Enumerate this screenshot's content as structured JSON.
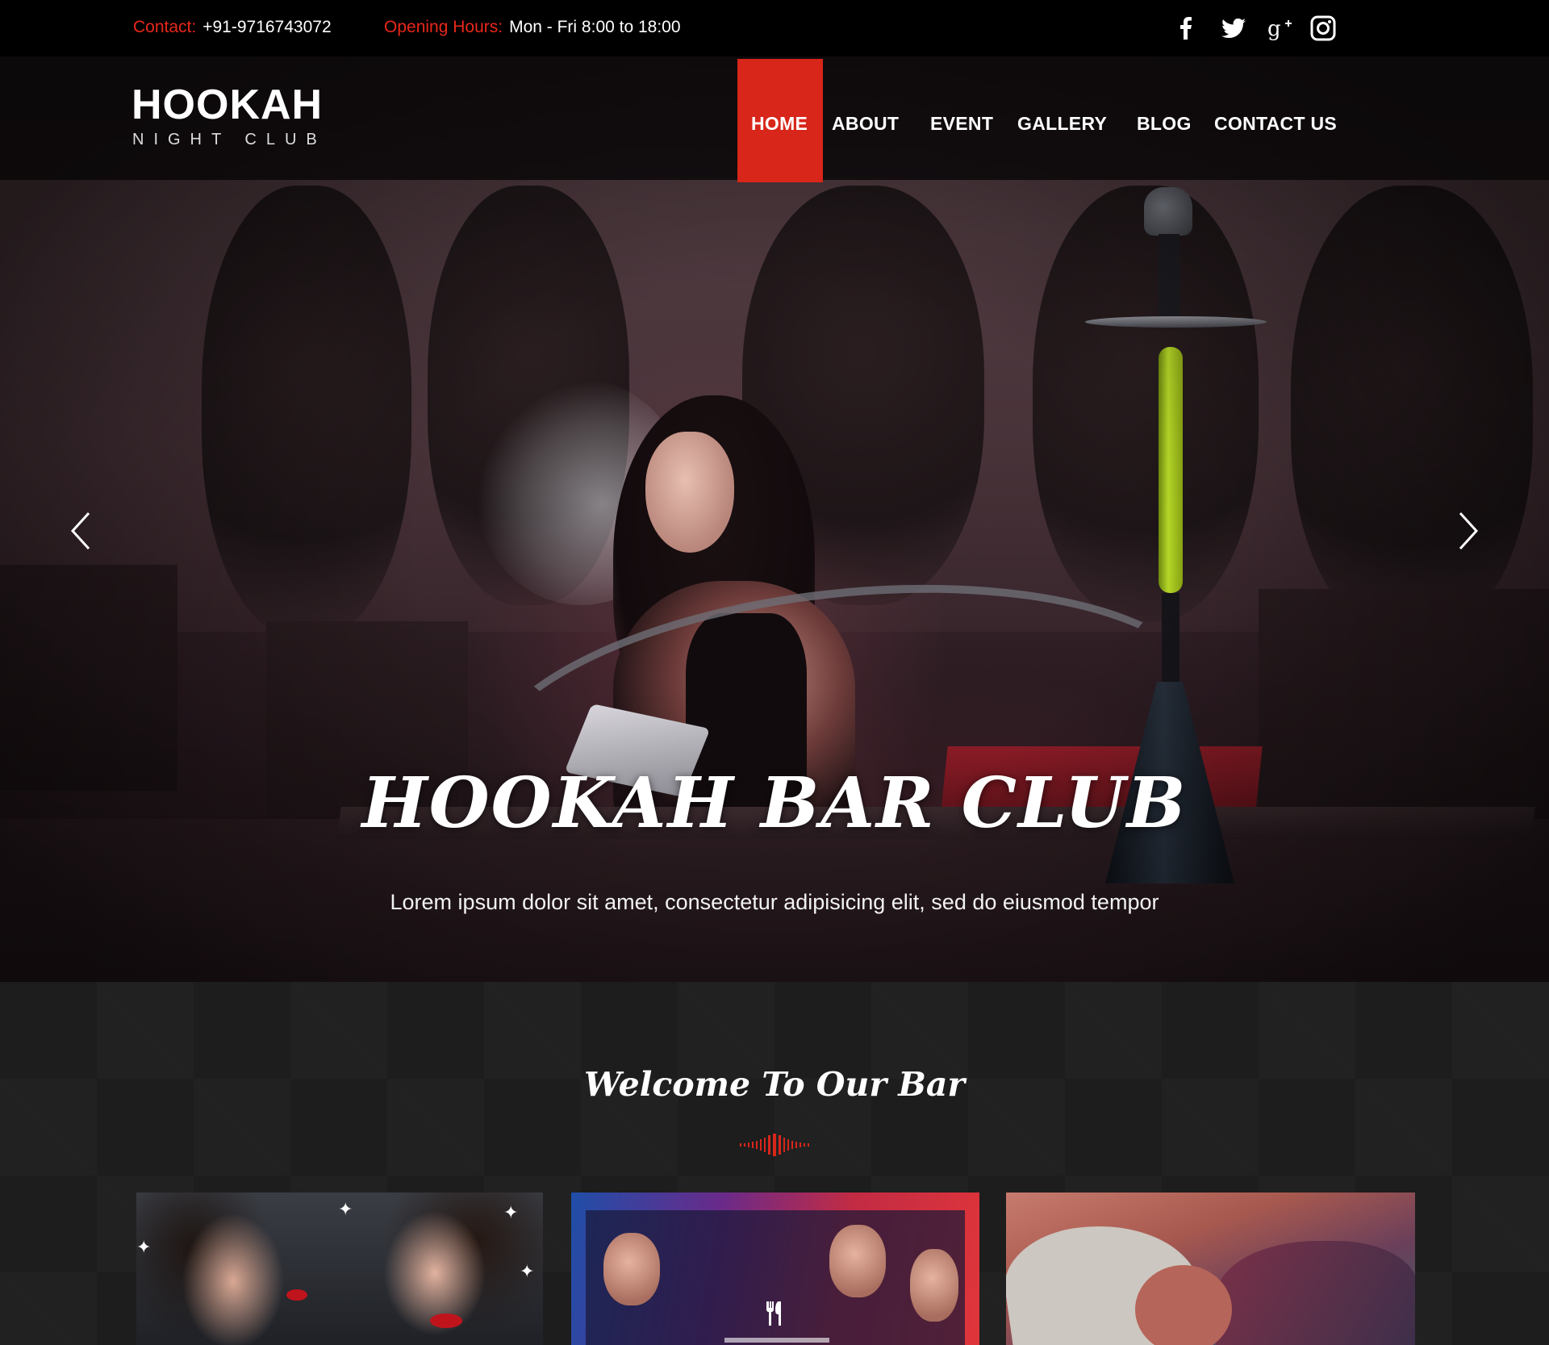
{
  "topbar": {
    "contact_label": "Contact:",
    "contact_value": "+91-9716743072",
    "hours_label": "Opening  Hours:",
    "hours_value": "Mon - Fri  8:00 to 18:00",
    "social": [
      "facebook-icon",
      "twitter-icon",
      "google-plus-icon",
      "instagram-icon"
    ]
  },
  "brand": {
    "title": "HOOKAH",
    "subtitle": "NIGHT CLUB"
  },
  "nav": {
    "items": [
      "HOME",
      "ABOUT",
      "EVENT",
      "GALLERY",
      "BLOG",
      "CONTACT  US"
    ],
    "active": "HOME"
  },
  "hero": {
    "title": "HOOKAH BAR CLUB",
    "subtitle": "Lorem ipsum dolor sit amet, consectetur adipisicing elit, sed do eiusmod tempor",
    "prev_icon": "chevron-left-icon",
    "next_icon": "chevron-right-icon"
  },
  "welcome": {
    "title": "Welcome To Our Bar",
    "cards": [
      "card-party",
      "card-restaurant",
      "card-dancer"
    ]
  },
  "colors": {
    "accent": "#d8261a",
    "topbar_bg": "#000000",
    "section_bg": "#1d1d1d"
  }
}
